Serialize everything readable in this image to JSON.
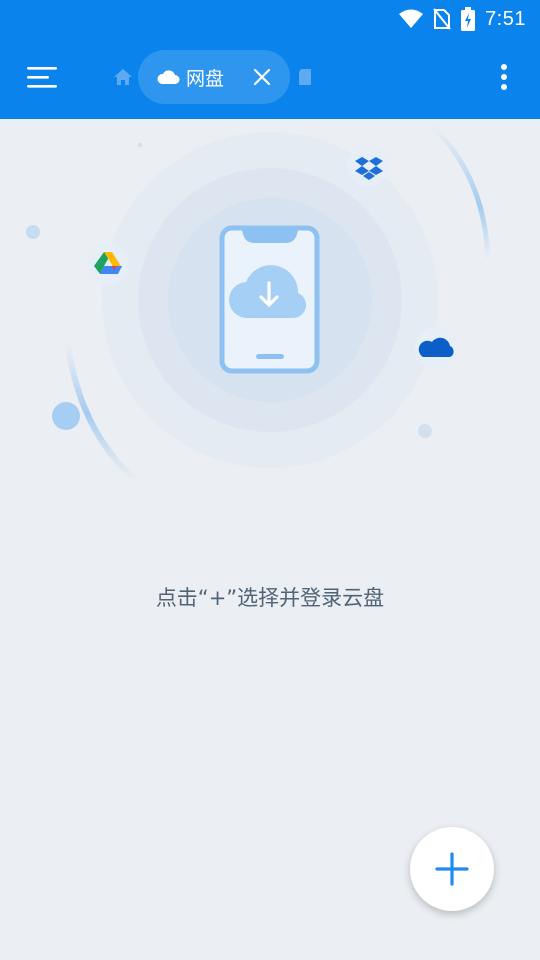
{
  "status_bar": {
    "time": "7:51",
    "icons": [
      "wifi-icon",
      "no-sim-icon",
      "battery-charging-icon"
    ]
  },
  "toolbar": {
    "menu_icon": "hamburger-menu-icon",
    "home_icon": "home-icon",
    "active_tab": {
      "label": "网盘",
      "icon": "cloud-icon",
      "close_icon": "close-icon"
    },
    "next_tab_icon": "phone-storage-icon",
    "more_icon": "more-vertical-icon"
  },
  "illustration": {
    "center_icon": "phone-cloud-download-icon",
    "services": [
      "dropbox-icon",
      "google-drive-icon",
      "onedrive-icon"
    ]
  },
  "empty_state": {
    "message": "点击“+”选择并登录云盘"
  },
  "fab": {
    "icon": "plus-icon"
  },
  "colors": {
    "primary": "#0a84ec",
    "background": "#ebeef2",
    "text": "#4f6478",
    "fab_plus": "#1e8cf0"
  }
}
